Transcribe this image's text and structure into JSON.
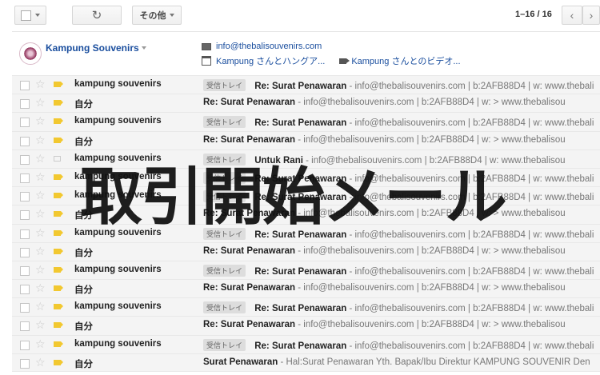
{
  "toolbar": {
    "more_label": "その他",
    "refresh_glyph": "↻",
    "pager": "1–16 / 16",
    "prev_glyph": "‹",
    "next_glyph": "›"
  },
  "contact": {
    "name": "Kampung Souvenirs",
    "email": "info@thebalisouvenirs.com",
    "chat_link": "Kampung さんとハングア...",
    "video_link": "Kampung さんとのビデオ..."
  },
  "label_text": "受信トレイ",
  "rows": [
    {
      "sender": "kampung souvenirs",
      "label": true,
      "subject": "Re: Surat Penawaran",
      "snippet": " - info@thebalisouvenirs.com | b:2AFB88D4 | w: www.thebali",
      "tag": true
    },
    {
      "sender": "自分",
      "label": false,
      "subject": "Re: Surat Penawaran",
      "snippet": " - info@thebalisouvenirs.com | b:2AFB88D4 | w: > www.thebalisou",
      "tag": true
    },
    {
      "sender": "kampung souvenirs",
      "label": true,
      "subject": "Re: Surat Penawaran",
      "snippet": " - info@thebalisouvenirs.com | b:2AFB88D4 | w: www.thebali",
      "tag": true
    },
    {
      "sender": "自分",
      "label": false,
      "subject": "Re: Surat Penawaran",
      "snippet": " - info@thebalisouvenirs.com | b:2AFB88D4 | w: > www.thebalisou",
      "tag": true
    },
    {
      "sender": "kampung souvenirs",
      "label": true,
      "subject": "Untuk Rani",
      "snippet": " - info@thebalisouvenirs.com | b:2AFB88D4 | w: www.thebalisou",
      "tag": false
    },
    {
      "sender": "kampung souvenirs",
      "label": true,
      "subject": "Re: Surat Penawaran",
      "snippet": " - info@thebalisouvenirs.com | b:2AFB88D4 | w: www.thebali",
      "tag": true
    },
    {
      "sender": "kampung souvenirs",
      "label": true,
      "subject": "Re: Surat Penawaran",
      "snippet": " - info@thebalisouvenirs.com | b:2AFB88D4 | w: www.thebali",
      "tag": true
    },
    {
      "sender": "自分",
      "label": false,
      "subject": "Re: Surat Penawaran",
      "snippet": " - info@thebalisouvenirs.com | b:2AFB88D4 | w: > www.thebalisou",
      "tag": true
    },
    {
      "sender": "kampung souvenirs",
      "label": true,
      "subject": "Re: Surat Penawaran",
      "snippet": " - info@thebalisouvenirs.com | b:2AFB88D4 | w: www.thebali",
      "tag": true
    },
    {
      "sender": "自分",
      "label": false,
      "subject": "Re: Surat Penawaran",
      "snippet": " - info@thebalisouvenirs.com | b:2AFB88D4 | w: > www.thebalisou",
      "tag": true
    },
    {
      "sender": "kampung souvenirs",
      "label": true,
      "subject": "Re: Surat Penawaran",
      "snippet": " - info@thebalisouvenirs.com | b:2AFB88D4 | w: www.thebali",
      "tag": true
    },
    {
      "sender": "自分",
      "label": false,
      "subject": "Re: Surat Penawaran",
      "snippet": " - info@thebalisouvenirs.com | b:2AFB88D4 | w: > www.thebalisou",
      "tag": true
    },
    {
      "sender": "kampung souvenirs",
      "label": true,
      "subject": "Re: Surat Penawaran",
      "snippet": " - info@thebalisouvenirs.com | b:2AFB88D4 | w: www.thebali",
      "tag": true
    },
    {
      "sender": "自分",
      "label": false,
      "subject": "Re: Surat Penawaran",
      "snippet": " - info@thebalisouvenirs.com | b:2AFB88D4 | w: > www.thebalisou",
      "tag": true
    },
    {
      "sender": "kampung souvenirs",
      "label": true,
      "subject": "Re: Surat Penawaran",
      "snippet": " - info@thebalisouvenirs.com | b:2AFB88D4 | w: www.thebali",
      "tag": true
    },
    {
      "sender": "自分",
      "label": false,
      "subject": "Surat Penawaran",
      "snippet": " - Hal:Surat Penawaran Yth. Bapak/Ibu Direktur KAMPUNG SOUVENIR Den",
      "tag": true
    }
  ],
  "overlay_text": "取引開始メール",
  "icons": {
    "checkbox": "checkbox-icon",
    "star": "star-icon",
    "tag": "importance-tag-icon",
    "mail": "mail-icon",
    "chat": "chat-icon",
    "video": "video-icon"
  },
  "colors": {
    "link": "#1a4e9e",
    "tag": "#f2c830",
    "row_bg": "#f4f4f4"
  }
}
